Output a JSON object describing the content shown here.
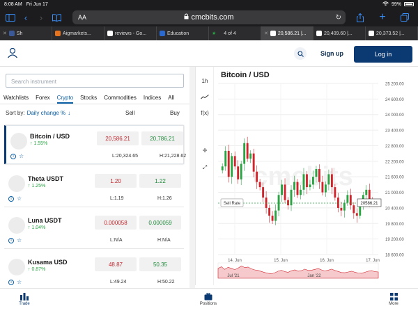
{
  "statusbar": {
    "time": "8:08 AM",
    "date": "Fri Jun 17",
    "battery": "99%"
  },
  "browser": {
    "aa_label": "AA",
    "url": "cmcbits.com",
    "tabs": [
      {
        "label": "Sh",
        "active": false
      },
      {
        "label": "Aigmarkets...",
        "active": false
      },
      {
        "label": "reviews - Go...",
        "active": false
      },
      {
        "label": "Education",
        "active": false
      },
      {
        "label": "4 of 4",
        "active": false
      },
      {
        "label": "20,586.21 |...",
        "active": true
      },
      {
        "label": "20,409.60 |...",
        "active": false
      },
      {
        "label": "20,373.52 |...",
        "active": false
      }
    ]
  },
  "header": {
    "signup": "Sign up",
    "login": "Log in"
  },
  "left": {
    "search_placeholder": "Search instrument",
    "categories": [
      "Watchlists",
      "Forex",
      "Crypto",
      "Stocks",
      "Commodities",
      "Indices",
      "All"
    ],
    "active_category": "Crypto",
    "sort_label": "Sort by:",
    "sort_value": "Daily change %",
    "sell_header": "Sell",
    "buy_header": "Buy",
    "rows": [
      {
        "name": "Bitcoin / USD",
        "change": "1.55%",
        "sell": "20,586.21",
        "buy": "20,786.21",
        "low": "L:20,324.65",
        "high": "H:21,228.62"
      },
      {
        "name": "Theta USDT",
        "change": "1.25%",
        "sell": "1.20",
        "buy": "1.22",
        "low": "L:1.19",
        "high": "H:1.26"
      },
      {
        "name": "Luna USDT",
        "change": "1.04%",
        "sell": "0.000058",
        "buy": "0.000059",
        "low": "L:N/A",
        "high": "H:N/A"
      },
      {
        "name": "Kusama USD",
        "change": "0.87%",
        "sell": "48.87",
        "buy": "50.35",
        "low": "L:49.24",
        "high": "H:50.22"
      }
    ]
  },
  "chart": {
    "title": "Bitcoin / USD",
    "timeframe": "1h",
    "fx_label": "f(x)",
    "sell_rate_label": "Sell Rate",
    "current_price": "20586.21",
    "watermark": "cmcbits",
    "colors": {
      "up": "#2aa343",
      "down": "#d0252d"
    }
  },
  "chart_data": {
    "type": "candlestick",
    "title": "Bitcoin / USD",
    "x_tick_labels": [
      "14. Jun",
      "15. Jun",
      "16. Jun",
      "17. Jun"
    ],
    "y_tick_labels": [
      "25 200.00",
      "24 600.00",
      "24 000.00",
      "23 400.00",
      "22 800.00",
      "22 200.00",
      "21 600.00",
      "21 000.00",
      "20 400.00",
      "19 800.00",
      "19 200.00",
      "18 600.00"
    ],
    "ylim": [
      18600,
      25200
    ],
    "current_price": 20586.21,
    "current_price_label": "20586.21",
    "close_series": [
      22000,
      22600,
      21600,
      22400,
      22000,
      21500,
      22100,
      22900,
      22300,
      22500,
      21800,
      21400,
      21200,
      20800,
      20400,
      20100,
      19900,
      20300,
      20900,
      21300,
      20700,
      20500,
      21100,
      21400,
      20900,
      21100,
      21700,
      21200,
      21300,
      21600,
      21900,
      21400,
      21000,
      21300,
      21700,
      21200,
      20800,
      20400,
      20300,
      20600,
      20900,
      20500,
      20200,
      20100,
      20500,
      20900,
      21100,
      20700,
      20600
    ],
    "navigator_ticks": [
      "Jul '21",
      "Jan '22"
    ]
  },
  "bottomnav": {
    "trade": "Trade",
    "positions": "Positions",
    "more": "More"
  }
}
